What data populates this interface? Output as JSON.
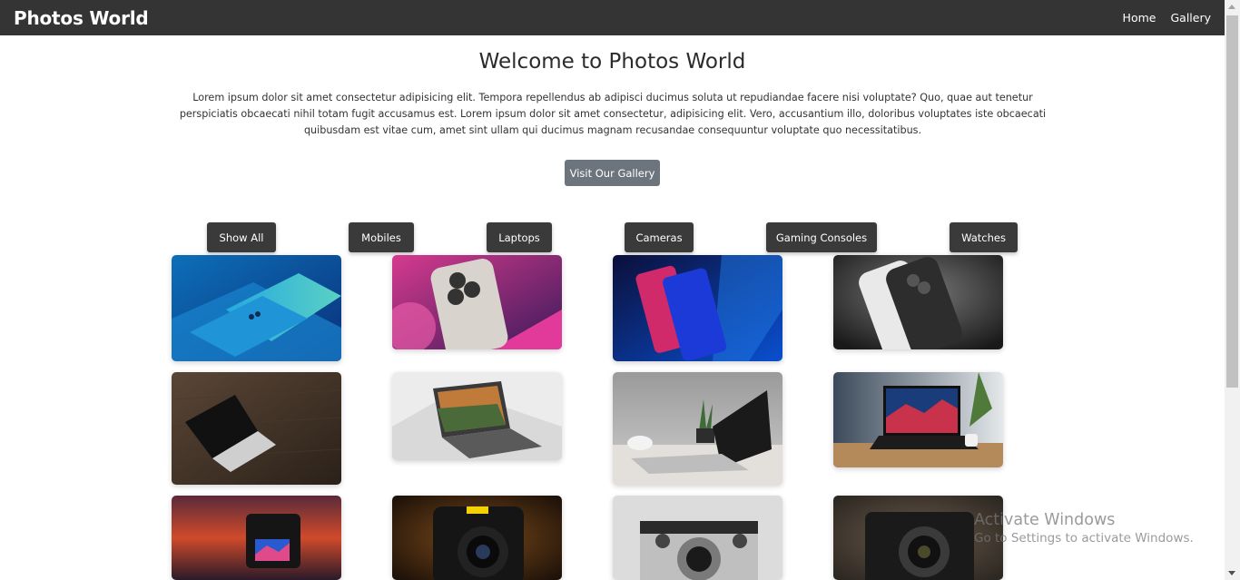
{
  "navbar": {
    "brand": "Photos World",
    "links": [
      "Home",
      "Gallery"
    ]
  },
  "hero": {
    "title": "Welcome to Photos World",
    "text": "Lorem ipsum dolor sit amet consectetur adipisicing elit. Tempora repellendus ab adipisci ducimus soluta ut repudiandae facere nisi voluptate? Quo, quae aut tenetur perspiciatis obcaecati nihil totam fugit accusamus est. Lorem ipsum dolor sit amet consectetur, adipisicing elit. Vero, accusantium illo, doloribus voluptates iste obcaecati quibusdam est vitae cum, amet sint ullam qui ducimus magnam recusandae consequuntur voluptate quo necessitatibus.",
    "button": "Visit Our Gallery"
  },
  "filters": [
    "Show All",
    "Mobiles",
    "Laptops",
    "Cameras",
    "Gaming Consoles",
    "Watches"
  ],
  "gallery": {
    "mobiles": [
      "mobile-photo",
      "mobile-photo",
      "mobile-photo",
      "mobile-photo"
    ],
    "laptops": [
      "laptop-photo",
      "laptop-photo",
      "laptop-photo",
      "laptop-photo"
    ],
    "cameras": [
      "camera-photo",
      "camera-photo",
      "camera-photo",
      "camera-photo"
    ]
  },
  "watermark": {
    "title": "Activate Windows",
    "subtitle": "Go to Settings to activate Windows."
  },
  "colors": {
    "navbar": "#343434",
    "hero_button": "#6c757d",
    "filter_button": "#3a3a3a"
  }
}
